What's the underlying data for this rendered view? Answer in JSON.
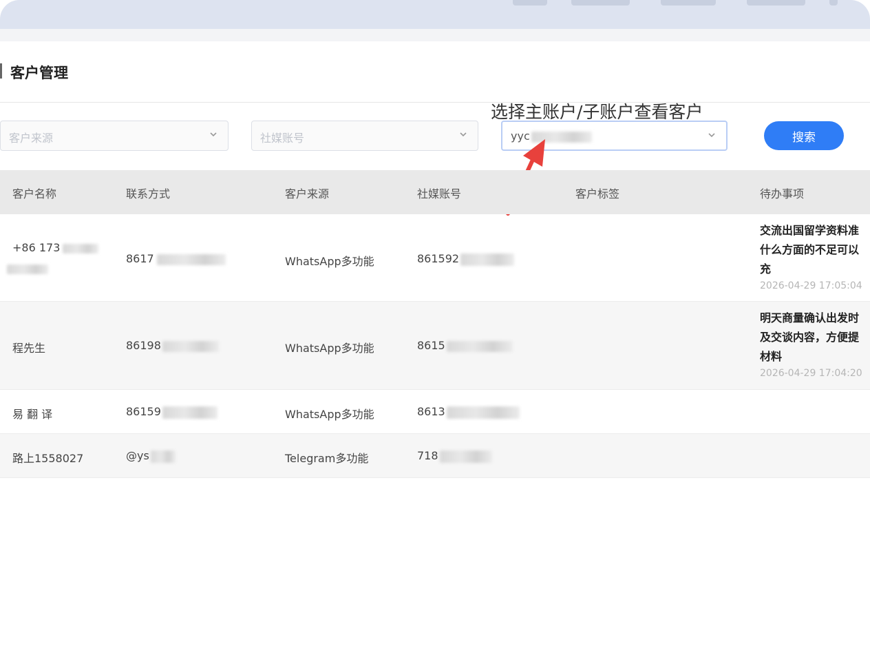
{
  "page": {
    "title": "客户管理"
  },
  "filters": {
    "source_placeholder": "客户来源",
    "social_placeholder": "社媒账号",
    "account_value_prefix": "yyc",
    "search_label": "搜索"
  },
  "annotation": {
    "text": "选择主账户/子账户查看客户",
    "color": "#e8413c"
  },
  "table": {
    "columns": [
      "客户名称",
      "联系方式",
      "客户来源",
      "社媒账号",
      "客户标签",
      "待办事项"
    ],
    "rows": [
      {
        "name": "+86 173",
        "contact": "8617",
        "source": "WhatsApp多功能",
        "social": "861592",
        "tag": "",
        "todo_lines": [
          "交流出国留学资料准",
          "什么方面的不足可以",
          "充"
        ],
        "todo_time": "2026-04-29 17:05:04"
      },
      {
        "name": "程先生",
        "contact": "86198",
        "source": "WhatsApp多功能",
        "social": "8615",
        "tag": "",
        "todo_lines": [
          "明天商量确认出发时",
          "及交谈内容，方便提",
          "材料"
        ],
        "todo_time": "2026-04-29 17:04:20"
      },
      {
        "name": "易 翻 译",
        "contact": "86159",
        "source": "WhatsApp多功能",
        "social": "8613",
        "tag": "",
        "todo_lines": [],
        "todo_time": ""
      },
      {
        "name": "路上1558027",
        "contact": "@ys",
        "source": "Telegram多功能",
        "social": "718",
        "tag": "",
        "todo_lines": [],
        "todo_time": ""
      }
    ]
  },
  "colors": {
    "primary": "#2f7df6",
    "header_bg": "#e9e9e9",
    "topbar_bg": "#dde3f0"
  }
}
